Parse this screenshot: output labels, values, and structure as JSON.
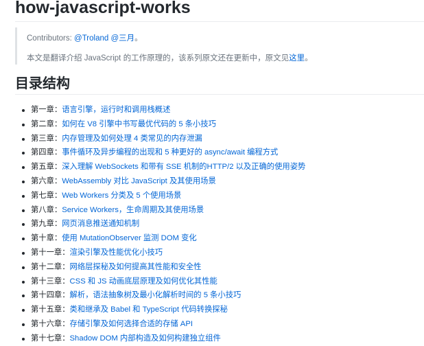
{
  "page": {
    "title": "how-javascript-works"
  },
  "quote": {
    "contributors_label": "Contributors: ",
    "contributor_1": "@Troland",
    "contributor_2": "@三月",
    "contributors_end": "。",
    "intro_text": "本文是翻译介绍 JavaScript 的工作原理的，该系列原文还在更新中，原文见",
    "intro_link": "这里",
    "intro_end": "。"
  },
  "toc": {
    "heading": "目录结构",
    "items": [
      {
        "chapter": "第一章",
        "title": "语言引擎，运行时和调用栈概述"
      },
      {
        "chapter": "第二章",
        "title": "如何在 V8 引擎中书写最优代码的 5 条小技巧"
      },
      {
        "chapter": "第三章",
        "title": "内存管理及如何处理 4 类常见的内存泄漏"
      },
      {
        "chapter": "第四章",
        "title": "事件循环及异步编程的出现和 5 种更好的 async/await 编程方式"
      },
      {
        "chapter": "第五章",
        "title": "深入理解 WebSockets 和带有 SSE 机制的HTTP/2 以及正确的使用姿势"
      },
      {
        "chapter": "第六章",
        "title": "WebAssembly 对比 JavaScript 及其使用场景"
      },
      {
        "chapter": "第七章",
        "title": "Web Workers 分类及 5 个使用场景"
      },
      {
        "chapter": "第八章",
        "title": "Service Workers，生命周期及其使用场景"
      },
      {
        "chapter": "第九章",
        "title": "网页消息推送通知机制"
      },
      {
        "chapter": "第十章",
        "title": "使用 MutationObserver 监测 DOM 变化"
      },
      {
        "chapter": "第十一章",
        "title": "渲染引擎及性能优化小技巧"
      },
      {
        "chapter": "第十二章",
        "title": "网络层探秘及如何提高其性能和安全性"
      },
      {
        "chapter": "第十三章",
        "title": "CSS 和 JS 动画底层原理及如何优化其性能"
      },
      {
        "chapter": "第十四章",
        "title": "解析，语法抽象树及最小化解析时间的 5 条小技巧"
      },
      {
        "chapter": "第十五章",
        "title": "类和继承及 Babel 和 TypeScript 代码转换探秘"
      },
      {
        "chapter": "第十六章",
        "title": "存储引擎及如何选择合适的存储 API"
      },
      {
        "chapter": "第十七章",
        "title": "Shadow DOM 内部构造及如何构建独立组件"
      }
    ]
  },
  "colors": {
    "link": "#0366d6",
    "text": "#24292e",
    "muted": "#6a737d",
    "quote_border": "#dfe2e5",
    "rule": "#eaecef"
  }
}
